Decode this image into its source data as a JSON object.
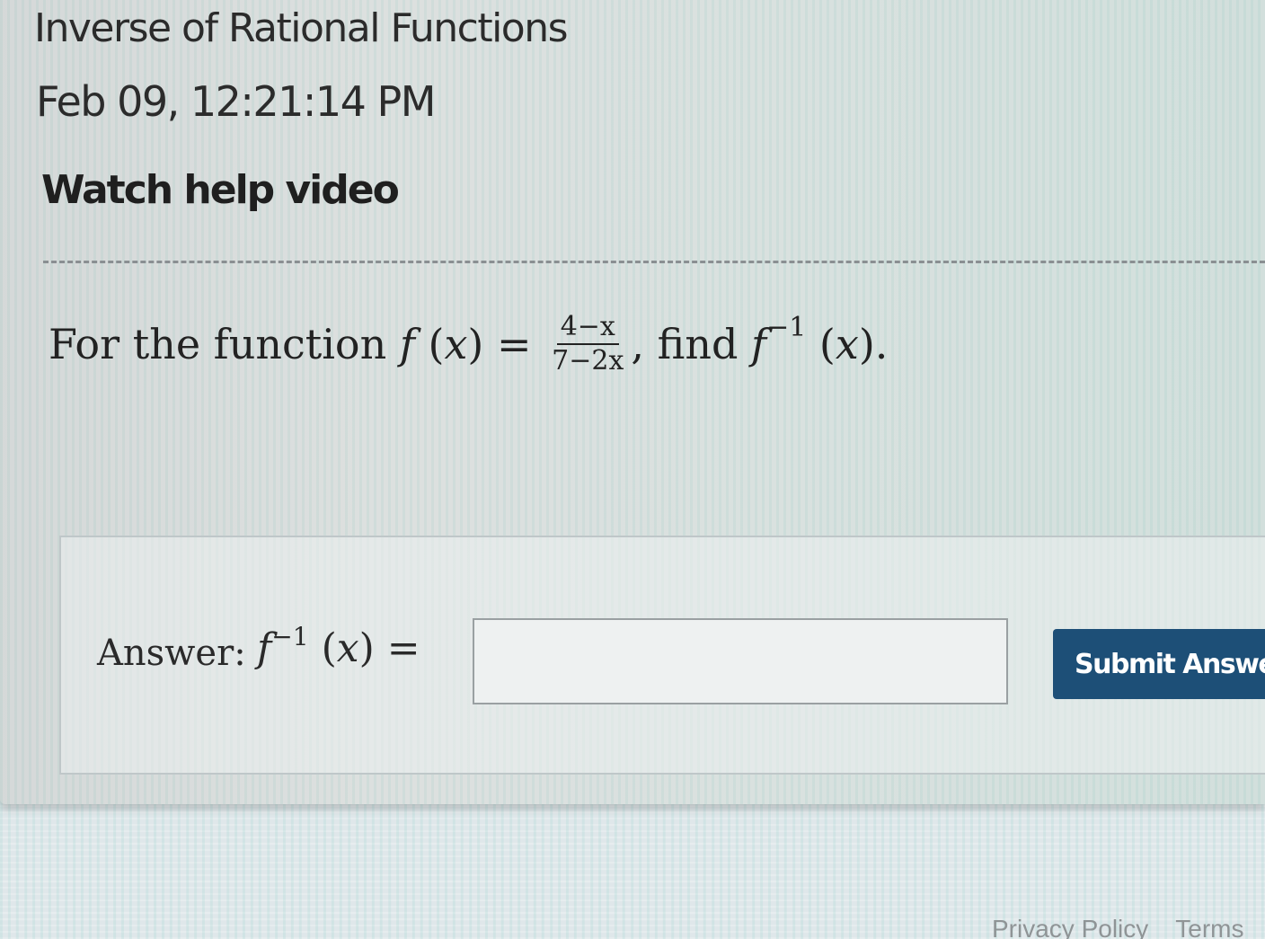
{
  "header": {
    "title": "Inverse of Rational Functions",
    "timestamp": "Feb 09, 12:21:14 PM",
    "help_link": "Watch help video"
  },
  "question": {
    "prefix": "For the function",
    "func_name": "f",
    "open_paren": "(",
    "var": "x",
    "close_paren": ")",
    "equals": "=",
    "numerator": "4−x",
    "denominator": "7−2x",
    "middle": ", find",
    "inverse_func": "f",
    "inverse_sup": "−1",
    "end": "."
  },
  "answer": {
    "label": "Answer:",
    "func": "f",
    "sup": "−1",
    "open_paren": "(",
    "var": "x",
    "close_paren": ")",
    "equals": "=",
    "input_value": "",
    "submit_label": "Submit Answer"
  },
  "footer": {
    "privacy": "Privacy Policy",
    "terms": "Terms"
  }
}
